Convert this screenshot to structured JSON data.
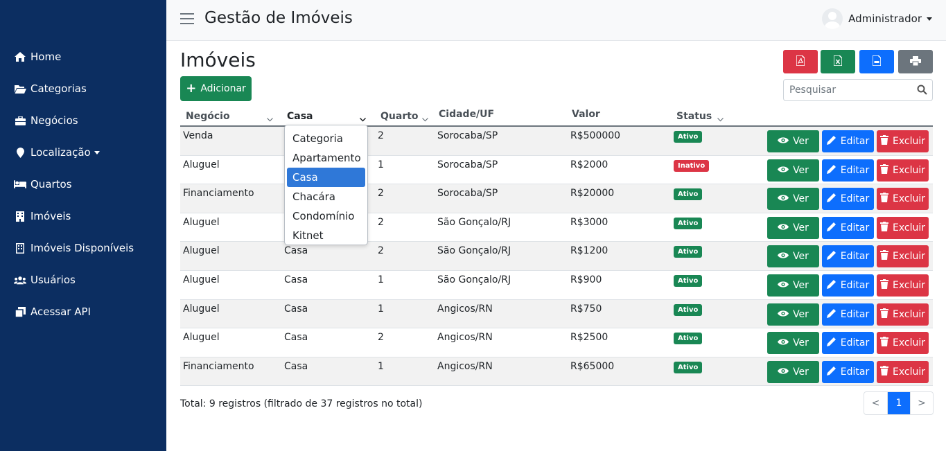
{
  "app": {
    "title": "Gestão de Imóveis"
  },
  "user": {
    "name": "Administrador"
  },
  "sidebar": {
    "items": [
      {
        "label": "Home",
        "icon": "home-icon"
      },
      {
        "label": "Categorias",
        "icon": "folder-open-icon"
      },
      {
        "label": "Negócios",
        "icon": "briefcase-icon"
      },
      {
        "label": "Localização",
        "icon": "map-marker-icon"
      },
      {
        "label": "Quartos",
        "icon": "bed-icon"
      },
      {
        "label": "Imóveis",
        "icon": "building-icon"
      },
      {
        "label": "Imóveis Disponíveis",
        "icon": "building-icon"
      },
      {
        "label": "Usuários",
        "icon": "users-icon"
      },
      {
        "label": "Acessar API",
        "icon": "clone-icon"
      }
    ]
  },
  "page": {
    "title": "Imóveis",
    "add_label": "Adicionar"
  },
  "export_buttons": [
    {
      "name": "pdf",
      "icon": "file-pdf-icon",
      "color": "#dc3545"
    },
    {
      "name": "excel",
      "icon": "file-excel-icon",
      "color": "#198754"
    },
    {
      "name": "csv",
      "icon": "file-csv-icon",
      "color": "#0d6efd"
    },
    {
      "name": "print",
      "icon": "print-icon",
      "color": "#6c757d"
    }
  ],
  "search": {
    "placeholder": "Pesquisar",
    "value": ""
  },
  "table": {
    "headers": [
      "Negócio",
      "Casa",
      "Quarto",
      "Cidade/UF",
      "Valor",
      "Status"
    ],
    "rows": [
      {
        "negocio": "Venda",
        "categoria": "Casa",
        "quarto": "2",
        "cidade": "Sorocaba/SP",
        "valor": "R$500000",
        "status": "Ativo"
      },
      {
        "negocio": "Aluguel",
        "categoria": "Casa",
        "quarto": "1",
        "cidade": "Sorocaba/SP",
        "valor": "R$2000",
        "status": "Inativo"
      },
      {
        "negocio": "Financiamento",
        "categoria": "Casa",
        "quarto": "2",
        "cidade": "Sorocaba/SP",
        "valor": "R$20000",
        "status": "Ativo"
      },
      {
        "negocio": "Aluguel",
        "categoria": "Casa",
        "quarto": "2",
        "cidade": "São Gonçalo/RJ",
        "valor": "R$3000",
        "status": "Ativo"
      },
      {
        "negocio": "Aluguel",
        "categoria": "Casa",
        "quarto": "2",
        "cidade": "São Gonçalo/RJ",
        "valor": "R$1200",
        "status": "Ativo"
      },
      {
        "negocio": "Aluguel",
        "categoria": "Casa",
        "quarto": "1",
        "cidade": "São Gonçalo/RJ",
        "valor": "R$900",
        "status": "Ativo"
      },
      {
        "negocio": "Aluguel",
        "categoria": "Casa",
        "quarto": "1",
        "cidade": "Angicos/RN",
        "valor": "R$750",
        "status": "Ativo"
      },
      {
        "negocio": "Aluguel",
        "categoria": "Casa",
        "quarto": "2",
        "cidade": "Angicos/RN",
        "valor": "R$2500",
        "status": "Ativo"
      },
      {
        "negocio": "Financiamento",
        "categoria": "Casa",
        "quarto": "1",
        "cidade": "Angicos/RN",
        "valor": "R$65000",
        "status": "Ativo"
      }
    ],
    "actions": {
      "view": "Ver",
      "edit": "Editar",
      "delete": "Excluir"
    }
  },
  "category_filter": {
    "options": [
      "Categoria",
      "Apartamento",
      "Casa",
      "Chacára",
      "Condomínio",
      "Kitnet"
    ],
    "selected": "Casa"
  },
  "footer": {
    "info": "Total: 9 registros (filtrado de 37 registros no total)"
  },
  "pagination": {
    "prev": "<",
    "current": "1",
    "next": ">"
  },
  "colors": {
    "sidebar": "#0c2e61",
    "success": "#198754",
    "primary": "#0d6efd",
    "danger": "#dc3545",
    "secondary": "#6c757d",
    "status_active": "#198754",
    "status_inactive": "#dc3545"
  }
}
